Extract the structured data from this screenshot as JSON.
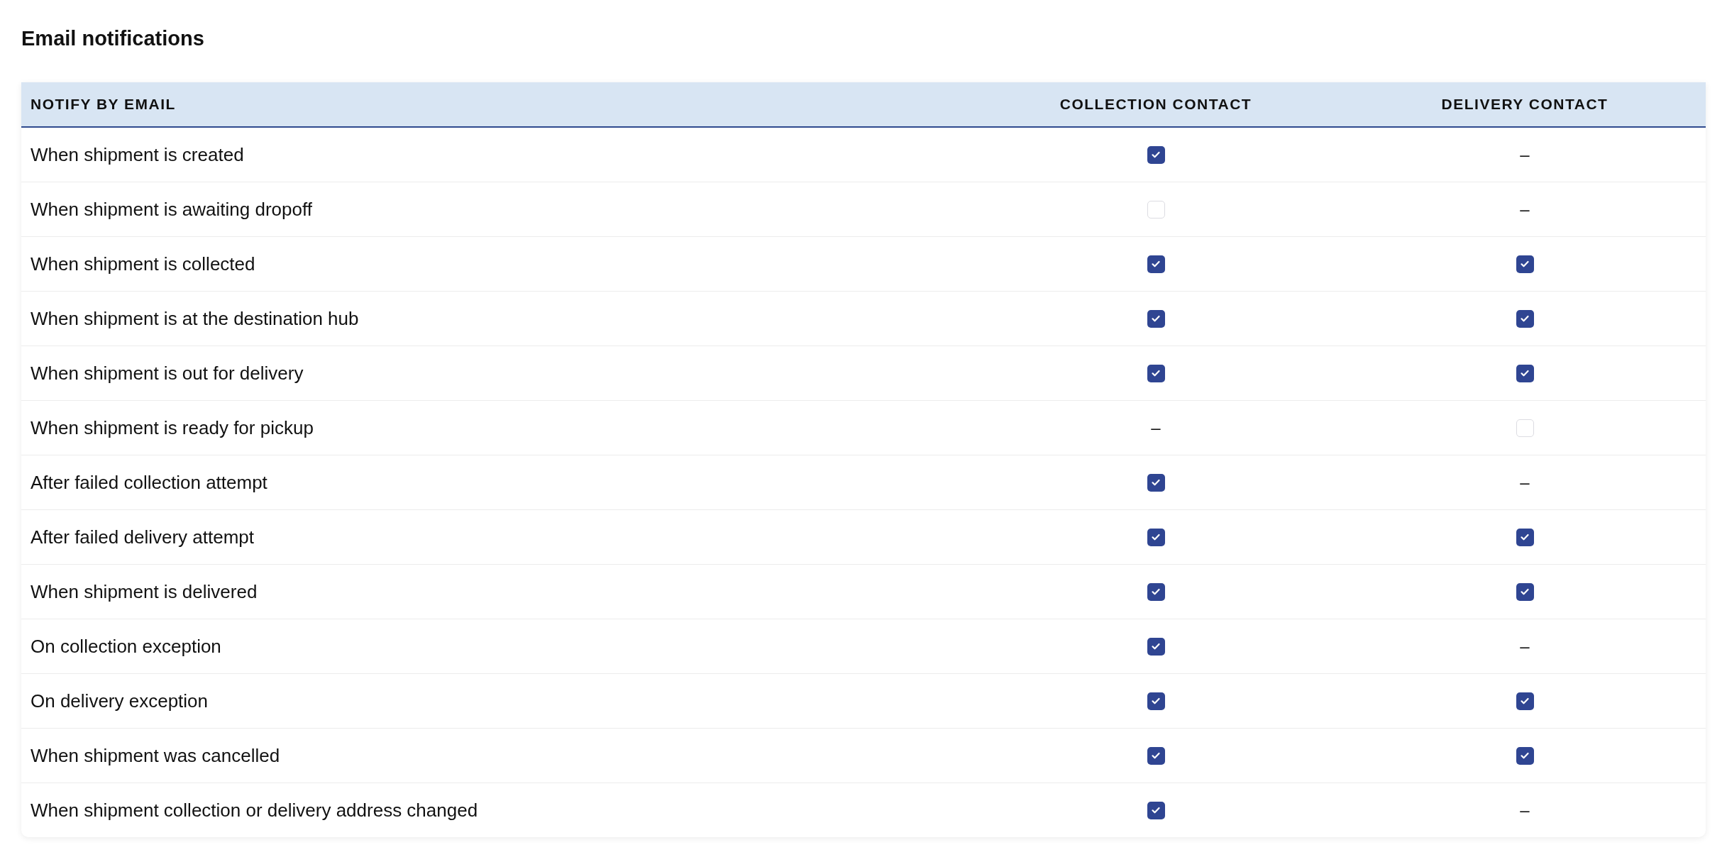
{
  "title": "Email notifications",
  "table": {
    "columns": [
      "NOTIFY BY EMAIL",
      "COLLECTION CONTACT",
      "DELIVERY CONTACT"
    ],
    "rows": [
      {
        "label": "When shipment is created",
        "collection": {
          "kind": "checkbox",
          "checked": true
        },
        "delivery": {
          "kind": "dash",
          "text": "–"
        }
      },
      {
        "label": "When shipment is awaiting dropoff",
        "collection": {
          "kind": "checkbox",
          "checked": false
        },
        "delivery": {
          "kind": "dash",
          "text": "–"
        }
      },
      {
        "label": "When shipment is collected",
        "collection": {
          "kind": "checkbox",
          "checked": true
        },
        "delivery": {
          "kind": "checkbox",
          "checked": true
        }
      },
      {
        "label": "When shipment is at the destination hub",
        "collection": {
          "kind": "checkbox",
          "checked": true
        },
        "delivery": {
          "kind": "checkbox",
          "checked": true
        }
      },
      {
        "label": "When shipment is out for delivery",
        "collection": {
          "kind": "checkbox",
          "checked": true
        },
        "delivery": {
          "kind": "checkbox",
          "checked": true
        }
      },
      {
        "label": "When shipment is ready for pickup",
        "collection": {
          "kind": "dash",
          "text": "–"
        },
        "delivery": {
          "kind": "checkbox",
          "checked": false
        }
      },
      {
        "label": "After failed collection attempt",
        "collection": {
          "kind": "checkbox",
          "checked": true
        },
        "delivery": {
          "kind": "dash",
          "text": "–"
        }
      },
      {
        "label": "After failed delivery attempt",
        "collection": {
          "kind": "checkbox",
          "checked": true
        },
        "delivery": {
          "kind": "checkbox",
          "checked": true
        }
      },
      {
        "label": "When shipment is delivered",
        "collection": {
          "kind": "checkbox",
          "checked": true
        },
        "delivery": {
          "kind": "checkbox",
          "checked": true
        }
      },
      {
        "label": "On collection exception",
        "collection": {
          "kind": "checkbox",
          "checked": true
        },
        "delivery": {
          "kind": "dash",
          "text": "–"
        }
      },
      {
        "label": "On delivery exception",
        "collection": {
          "kind": "checkbox",
          "checked": true
        },
        "delivery": {
          "kind": "checkbox",
          "checked": true
        }
      },
      {
        "label": "When shipment was cancelled",
        "collection": {
          "kind": "checkbox",
          "checked": true
        },
        "delivery": {
          "kind": "checkbox",
          "checked": true
        }
      },
      {
        "label": "When shipment collection or delivery address changed",
        "collection": {
          "kind": "checkbox",
          "checked": true
        },
        "delivery": {
          "kind": "dash",
          "text": "–"
        }
      }
    ]
  }
}
